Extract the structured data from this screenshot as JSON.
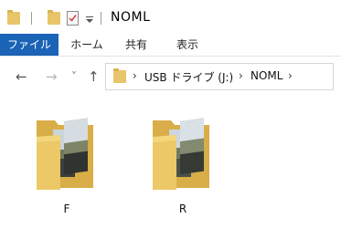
{
  "title_bar": {
    "title": "NOML",
    "icons": [
      "folder-icon",
      "properties-check-icon",
      "customize-dropdown-icon"
    ]
  },
  "ribbon": {
    "tabs": [
      {
        "label": "ファイル",
        "active": true
      },
      {
        "label": "ホーム"
      },
      {
        "label": "共有"
      },
      {
        "label": "表示"
      }
    ]
  },
  "nav": {
    "back_icon": "←",
    "forward_icon": "→",
    "recent_icon": "˅",
    "up_icon": "↑"
  },
  "address": {
    "separator": "›",
    "crumbs": [
      "USB ドライブ (J:)",
      "NOML"
    ]
  },
  "items": [
    {
      "name": "F"
    },
    {
      "name": "R"
    }
  ],
  "colors": {
    "accent": "#1a63b6",
    "folder": "#e8c56a"
  }
}
